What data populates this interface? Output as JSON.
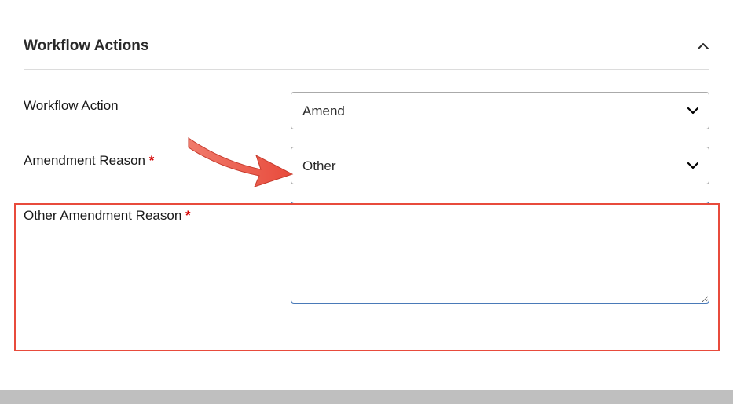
{
  "section": {
    "title": "Workflow Actions"
  },
  "form": {
    "workflow_action_label": "Workflow Action",
    "workflow_action_value": "Amend",
    "amendment_reason_label": "Amendment Reason ",
    "amendment_reason_value": "Other",
    "other_reason_label": "Other Amendment Reason ",
    "other_reason_value": ""
  },
  "colors": {
    "annotation_red": "#e84b3c",
    "required_red": "#d40000"
  }
}
